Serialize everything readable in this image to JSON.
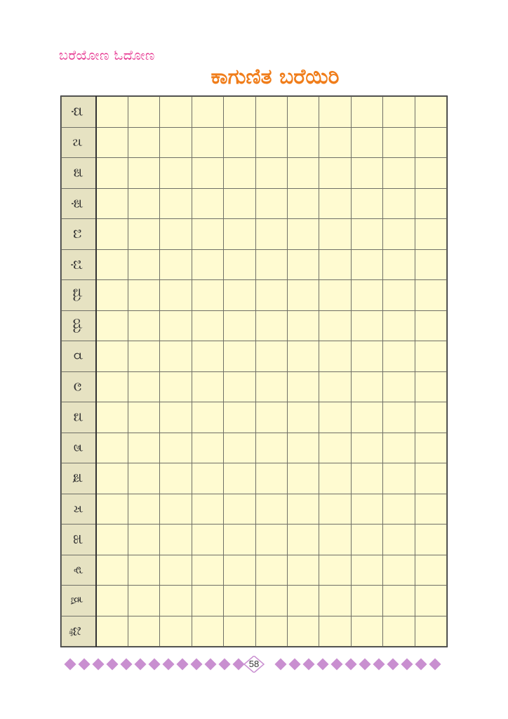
{
  "header": {
    "book_label": "ಬರೆಯೋಣ ಓದೋಣ",
    "title": "ಕಾಗುಣಿತ ಬರೆಯಿರಿ"
  },
  "grid": {
    "letters": [
      "ಧ",
      "ನ",
      "ಪ",
      "ಫ",
      "ಬ",
      "ಭ",
      "ಮ",
      "ಯ",
      "ರ",
      "ಲ",
      "ವ",
      "ಶ",
      "ಷ",
      "ಸ",
      "ಹ",
      "ಳ",
      "ಕ್ಷ",
      "ಜ್ಞ"
    ],
    "blank_columns": 11
  },
  "footer": {
    "page_number": "58",
    "band_color": "#c98fd0"
  },
  "colors": {
    "label": "#e6348f",
    "title": "#f07d1a",
    "grid_fill": "#fffbd1",
    "letter_column_fill": "#e6e2c2"
  }
}
